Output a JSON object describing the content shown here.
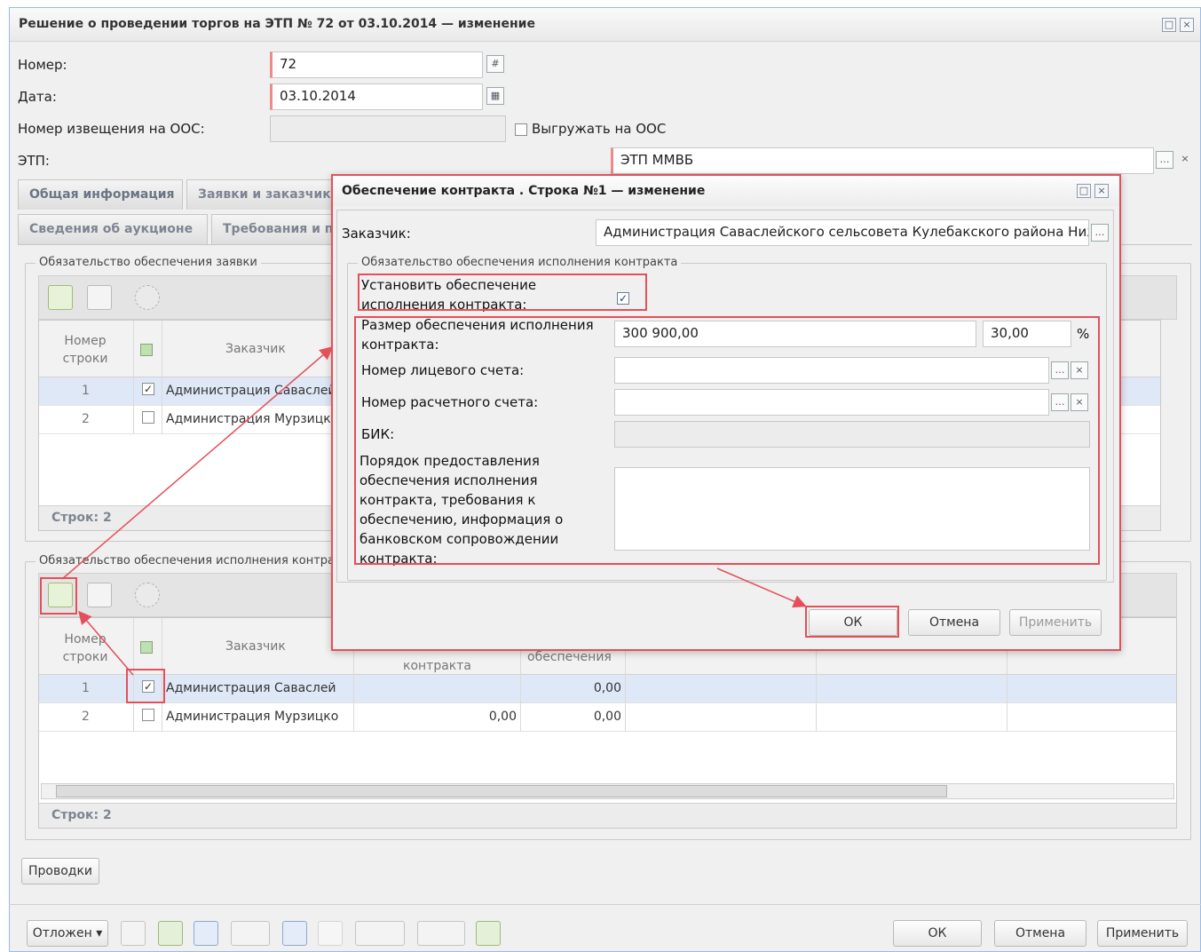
{
  "window": {
    "title": "Решение о проведении торгов на ЭТП № 72 от 03.10.2014 — изменение",
    "max_icon": "□",
    "close_icon": "×"
  },
  "form": {
    "number_label": "Номер:",
    "number_value": "72",
    "date_label": "Дата:",
    "date_value": "03.10.2014",
    "notice_label": "Номер извещения на ООС:",
    "notice_value": "",
    "upload_label": "Выгружать на ООС",
    "etp_label": "ЭТП:",
    "etp_value": "ЭТП ММВБ"
  },
  "tabs_row1": [
    "Общая информация",
    "Заявки и заказчики"
  ],
  "tabs_row2": [
    "Сведения об аукционе",
    "Требования и п"
  ],
  "section1": {
    "legend": "Обязательство обеспечения заявки",
    "col_number": "Номер строки",
    "col_customer": "Заказчик",
    "rows": [
      {
        "num": "1",
        "checked": true,
        "customer": "Администрация Саваслейского"
      },
      {
        "num": "2",
        "checked": false,
        "customer": "Администрация Мурзицкого"
      }
    ],
    "footer": "Строк: 2"
  },
  "section2": {
    "legend": "Обязательство обеспечения исполнения контракта",
    "col_number": "Номер строки",
    "col_customer": "Заказчик",
    "col_size": "контракта",
    "col_provide": "обеспечения",
    "rows": [
      {
        "num": "1",
        "checked": true,
        "customer": "Администрация Саваслей",
        "size": "",
        "provide": "0,00"
      },
      {
        "num": "2",
        "checked": false,
        "customer": "Администрация Мурзицко",
        "size": "0,00",
        "provide": "0,00"
      }
    ],
    "footer": "Строк: 2"
  },
  "provodki_button": "Проводки",
  "bottom_bar": {
    "status_button": "Отложен",
    "ok": "ОК",
    "cancel": "Отмена",
    "apply": "Применить"
  },
  "dialog": {
    "title": "Обеспечение контракта . Строка №1 — изменение",
    "customer_label": "Заказчик:",
    "customer_value": "Администрация Саваслейского сельсовета Кулебакского района Ниж",
    "group_legend": "Обязательство обеспечения исполнения контракта",
    "set_security_label": "Установить обеспечение исполнения контракта:",
    "set_security_checked": true,
    "size_label": "Размер обеспечения исполнения контракта:",
    "size_value": "300 900,00",
    "percent_value": "30,00",
    "percent_sign": "%",
    "personal_account_label": "Номер лицевого счета:",
    "personal_account_value": "",
    "settlement_account_label": "Номер расчетного счета:",
    "settlement_account_value": "",
    "bik_label": "БИК:",
    "bik_value": "",
    "procedure_label": "Порядок предоставления обеспечения исполнения контракта, требования к обеспечению, информация о банковском сопровождении контракта:",
    "procedure_value": "",
    "ok": "ОК",
    "cancel": "Отмена",
    "apply": "Применить"
  },
  "colors": {
    "highlight_red": "#e4505a",
    "selection": "#dfe8f6",
    "window_border": "#99bbe8"
  }
}
